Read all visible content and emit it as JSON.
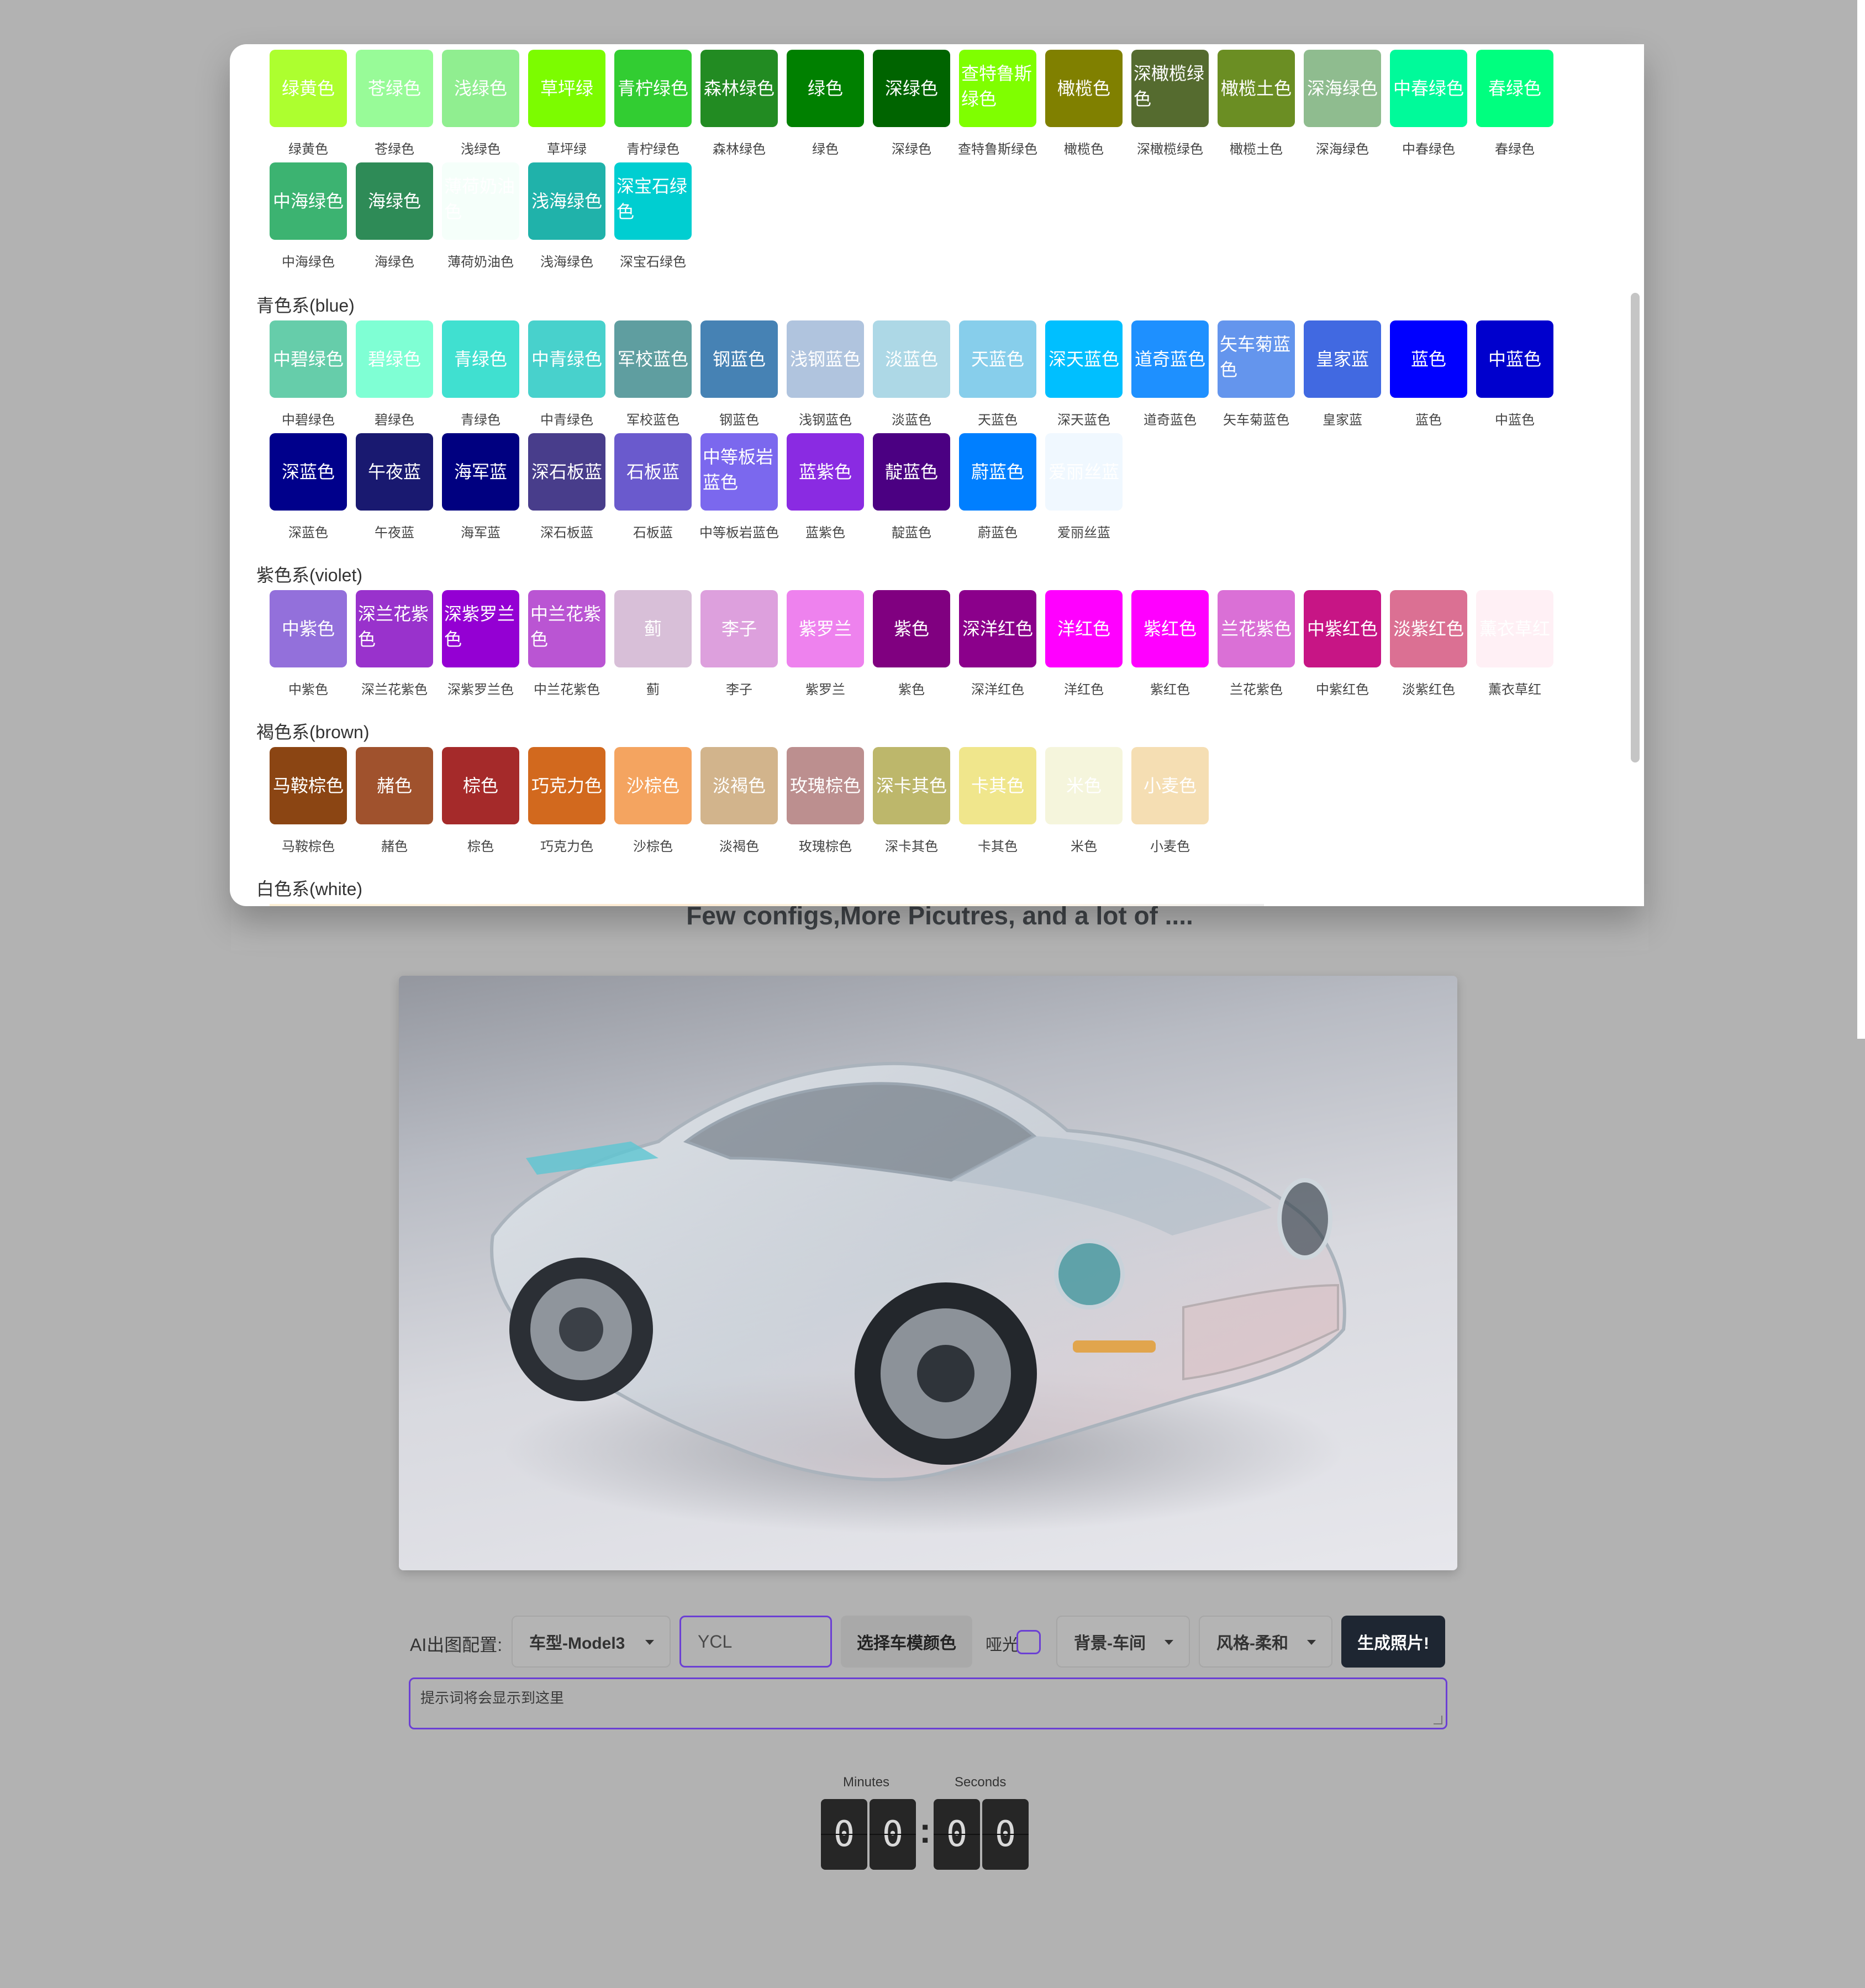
{
  "groups": [
    {
      "title": "",
      "rows": [
        [
          {
            "name": "绿黄色",
            "color": "#adff2f"
          },
          {
            "name": "苍绿色",
            "color": "#98fb98"
          },
          {
            "name": "浅绿色",
            "color": "#90ee90"
          },
          {
            "name": "草坪绿",
            "color": "#7cfc00"
          },
          {
            "name": "青柠绿色",
            "color": "#32cd32"
          },
          {
            "name": "森林绿色",
            "color": "#228b22"
          },
          {
            "name": "绿色",
            "color": "#008000"
          },
          {
            "name": "深绿色",
            "color": "#006400"
          },
          {
            "name": "查特鲁斯绿色",
            "color": "#7fff00"
          },
          {
            "name": "橄榄色",
            "color": "#808000"
          },
          {
            "name": "深橄榄绿色",
            "color": "#556b2f"
          },
          {
            "name": "橄榄土色",
            "color": "#6b8e23"
          },
          {
            "name": "深海绿色",
            "color": "#8fbc8f"
          },
          {
            "name": "中春绿色",
            "color": "#00fa9a"
          },
          {
            "name": "春绿色",
            "color": "#00ff7f"
          }
        ],
        [
          {
            "name": "中海绿色",
            "color": "#3cb371"
          },
          {
            "name": "海绿色",
            "color": "#2e8b57"
          },
          {
            "name": "薄荷奶油色",
            "color": "#f5fffa"
          },
          {
            "name": "浅海绿色",
            "color": "#20b2aa"
          },
          {
            "name": "深宝石绿色",
            "color": "#00ced1"
          }
        ]
      ]
    },
    {
      "title": "青色系(blue)",
      "rows": [
        [
          {
            "name": "中碧绿色",
            "color": "#66cdaa"
          },
          {
            "name": "碧绿色",
            "color": "#7fffd4"
          },
          {
            "name": "青绿色",
            "color": "#40e0d0"
          },
          {
            "name": "中青绿色",
            "color": "#48d1cc"
          },
          {
            "name": "军校蓝色",
            "color": "#5f9ea0"
          },
          {
            "name": "钢蓝色",
            "color": "#4682b4"
          },
          {
            "name": "浅钢蓝色",
            "color": "#b0c4de"
          },
          {
            "name": "淡蓝色",
            "color": "#add8e6"
          },
          {
            "name": "天蓝色",
            "color": "#87ceeb"
          },
          {
            "name": "深天蓝色",
            "color": "#00bfff"
          },
          {
            "name": "道奇蓝色",
            "color": "#1e90ff"
          },
          {
            "name": "矢车菊蓝色",
            "color": "#6495ed"
          },
          {
            "name": "皇家蓝",
            "color": "#4169e1"
          },
          {
            "name": "蓝色",
            "color": "#0000ff"
          },
          {
            "name": "中蓝色",
            "color": "#0000cd"
          }
        ],
        [
          {
            "name": "深蓝色",
            "color": "#00008b"
          },
          {
            "name": "午夜蓝",
            "color": "#191970"
          },
          {
            "name": "海军蓝",
            "color": "#000080"
          },
          {
            "name": "深石板蓝",
            "color": "#483d8b"
          },
          {
            "name": "石板蓝",
            "color": "#6a5acd"
          },
          {
            "name": "中等板岩蓝色",
            "color": "#7b68ee"
          },
          {
            "name": "蓝紫色",
            "color": "#8a2be2"
          },
          {
            "name": "靛蓝色",
            "color": "#4b0082"
          },
          {
            "name": "蔚蓝色",
            "color": "#007fff"
          },
          {
            "name": "爱丽丝蓝",
            "color": "#f0f8ff"
          }
        ]
      ]
    },
    {
      "title": "紫色系(violet)",
      "rows": [
        [
          {
            "name": "中紫色",
            "color": "#9370db"
          },
          {
            "name": "深兰花紫色",
            "color": "#9932cc"
          },
          {
            "name": "深紫罗兰色",
            "color": "#9400d3"
          },
          {
            "name": "中兰花紫色",
            "color": "#ba55d3"
          },
          {
            "name": "蓟",
            "color": "#d8bfd8"
          },
          {
            "name": "李子",
            "color": "#dda0dd"
          },
          {
            "name": "紫罗兰",
            "color": "#ee82ee"
          },
          {
            "name": "紫色",
            "color": "#800080"
          },
          {
            "name": "深洋红色",
            "color": "#8b008b"
          },
          {
            "name": "洋红色",
            "color": "#ff00ff"
          },
          {
            "name": "紫红色",
            "color": "#ff00ff"
          },
          {
            "name": "兰花紫色",
            "color": "#da70d6"
          },
          {
            "name": "中紫红色",
            "color": "#c71585"
          },
          {
            "name": "淡紫红色",
            "color": "#db7093"
          },
          {
            "name": "薰衣草红",
            "color": "#fff0f5"
          }
        ]
      ]
    },
    {
      "title": "褐色系(brown)",
      "rows": [
        [
          {
            "name": "马鞍棕色",
            "color": "#8b4513"
          },
          {
            "name": "赭色",
            "color": "#a0522d"
          },
          {
            "name": "棕色",
            "color": "#a52a2a"
          },
          {
            "name": "巧克力色",
            "color": "#d2691e"
          },
          {
            "name": "沙棕色",
            "color": "#f4a460"
          },
          {
            "name": "淡褐色",
            "color": "#d2b48c"
          },
          {
            "name": "玫瑰棕色",
            "color": "#bc8f8f"
          },
          {
            "name": "深卡其色",
            "color": "#bdb76b"
          },
          {
            "name": "卡其色",
            "color": "#f0e68c"
          },
          {
            "name": "米色",
            "color": "#f5f5dc"
          },
          {
            "name": "小麦色",
            "color": "#f5deb3"
          }
        ]
      ]
    },
    {
      "title": "白色系(white)",
      "rows": []
    }
  ],
  "hero_text": "Few configs,More Picutres, and a lot of ....",
  "controls": {
    "label": "AI出图配置:",
    "model_select": "车型-Model3",
    "name_input": "YCL",
    "color_button": "选择车模颜色",
    "matte_label": "哑光",
    "matte_checked": false,
    "background_select": "背景-车间",
    "style_select": "风格-柔和",
    "generate_button": "生成照片!",
    "prompt_placeholder": "提示词将会显示到这里"
  },
  "timer": {
    "minutes_label": "Minutes",
    "seconds_label": "Seconds",
    "digits": [
      "0",
      "0",
      "0",
      "0"
    ]
  }
}
